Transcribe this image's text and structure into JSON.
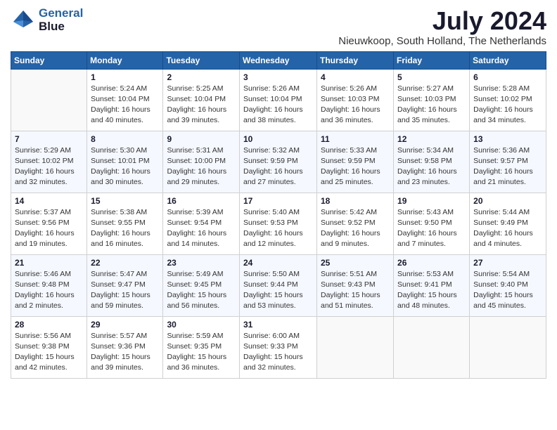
{
  "logo": {
    "line1": "General",
    "line2": "Blue"
  },
  "title": "July 2024",
  "subtitle": "Nieuwkoop, South Holland, The Netherlands",
  "days_of_week": [
    "Sunday",
    "Monday",
    "Tuesday",
    "Wednesday",
    "Thursday",
    "Friday",
    "Saturday"
  ],
  "weeks": [
    [
      {
        "day": "",
        "info": ""
      },
      {
        "day": "1",
        "info": "Sunrise: 5:24 AM\nSunset: 10:04 PM\nDaylight: 16 hours\nand 40 minutes."
      },
      {
        "day": "2",
        "info": "Sunrise: 5:25 AM\nSunset: 10:04 PM\nDaylight: 16 hours\nand 39 minutes."
      },
      {
        "day": "3",
        "info": "Sunrise: 5:26 AM\nSunset: 10:04 PM\nDaylight: 16 hours\nand 38 minutes."
      },
      {
        "day": "4",
        "info": "Sunrise: 5:26 AM\nSunset: 10:03 PM\nDaylight: 16 hours\nand 36 minutes."
      },
      {
        "day": "5",
        "info": "Sunrise: 5:27 AM\nSunset: 10:03 PM\nDaylight: 16 hours\nand 35 minutes."
      },
      {
        "day": "6",
        "info": "Sunrise: 5:28 AM\nSunset: 10:02 PM\nDaylight: 16 hours\nand 34 minutes."
      }
    ],
    [
      {
        "day": "7",
        "info": "Sunrise: 5:29 AM\nSunset: 10:02 PM\nDaylight: 16 hours\nand 32 minutes."
      },
      {
        "day": "8",
        "info": "Sunrise: 5:30 AM\nSunset: 10:01 PM\nDaylight: 16 hours\nand 30 minutes."
      },
      {
        "day": "9",
        "info": "Sunrise: 5:31 AM\nSunset: 10:00 PM\nDaylight: 16 hours\nand 29 minutes."
      },
      {
        "day": "10",
        "info": "Sunrise: 5:32 AM\nSunset: 9:59 PM\nDaylight: 16 hours\nand 27 minutes."
      },
      {
        "day": "11",
        "info": "Sunrise: 5:33 AM\nSunset: 9:59 PM\nDaylight: 16 hours\nand 25 minutes."
      },
      {
        "day": "12",
        "info": "Sunrise: 5:34 AM\nSunset: 9:58 PM\nDaylight: 16 hours\nand 23 minutes."
      },
      {
        "day": "13",
        "info": "Sunrise: 5:36 AM\nSunset: 9:57 PM\nDaylight: 16 hours\nand 21 minutes."
      }
    ],
    [
      {
        "day": "14",
        "info": "Sunrise: 5:37 AM\nSunset: 9:56 PM\nDaylight: 16 hours\nand 19 minutes."
      },
      {
        "day": "15",
        "info": "Sunrise: 5:38 AM\nSunset: 9:55 PM\nDaylight: 16 hours\nand 16 minutes."
      },
      {
        "day": "16",
        "info": "Sunrise: 5:39 AM\nSunset: 9:54 PM\nDaylight: 16 hours\nand 14 minutes."
      },
      {
        "day": "17",
        "info": "Sunrise: 5:40 AM\nSunset: 9:53 PM\nDaylight: 16 hours\nand 12 minutes."
      },
      {
        "day": "18",
        "info": "Sunrise: 5:42 AM\nSunset: 9:52 PM\nDaylight: 16 hours\nand 9 minutes."
      },
      {
        "day": "19",
        "info": "Sunrise: 5:43 AM\nSunset: 9:50 PM\nDaylight: 16 hours\nand 7 minutes."
      },
      {
        "day": "20",
        "info": "Sunrise: 5:44 AM\nSunset: 9:49 PM\nDaylight: 16 hours\nand 4 minutes."
      }
    ],
    [
      {
        "day": "21",
        "info": "Sunrise: 5:46 AM\nSunset: 9:48 PM\nDaylight: 16 hours\nand 2 minutes."
      },
      {
        "day": "22",
        "info": "Sunrise: 5:47 AM\nSunset: 9:47 PM\nDaylight: 15 hours\nand 59 minutes."
      },
      {
        "day": "23",
        "info": "Sunrise: 5:49 AM\nSunset: 9:45 PM\nDaylight: 15 hours\nand 56 minutes."
      },
      {
        "day": "24",
        "info": "Sunrise: 5:50 AM\nSunset: 9:44 PM\nDaylight: 15 hours\nand 53 minutes."
      },
      {
        "day": "25",
        "info": "Sunrise: 5:51 AM\nSunset: 9:43 PM\nDaylight: 15 hours\nand 51 minutes."
      },
      {
        "day": "26",
        "info": "Sunrise: 5:53 AM\nSunset: 9:41 PM\nDaylight: 15 hours\nand 48 minutes."
      },
      {
        "day": "27",
        "info": "Sunrise: 5:54 AM\nSunset: 9:40 PM\nDaylight: 15 hours\nand 45 minutes."
      }
    ],
    [
      {
        "day": "28",
        "info": "Sunrise: 5:56 AM\nSunset: 9:38 PM\nDaylight: 15 hours\nand 42 minutes."
      },
      {
        "day": "29",
        "info": "Sunrise: 5:57 AM\nSunset: 9:36 PM\nDaylight: 15 hours\nand 39 minutes."
      },
      {
        "day": "30",
        "info": "Sunrise: 5:59 AM\nSunset: 9:35 PM\nDaylight: 15 hours\nand 36 minutes."
      },
      {
        "day": "31",
        "info": "Sunrise: 6:00 AM\nSunset: 9:33 PM\nDaylight: 15 hours\nand 32 minutes."
      },
      {
        "day": "",
        "info": ""
      },
      {
        "day": "",
        "info": ""
      },
      {
        "day": "",
        "info": ""
      }
    ]
  ]
}
